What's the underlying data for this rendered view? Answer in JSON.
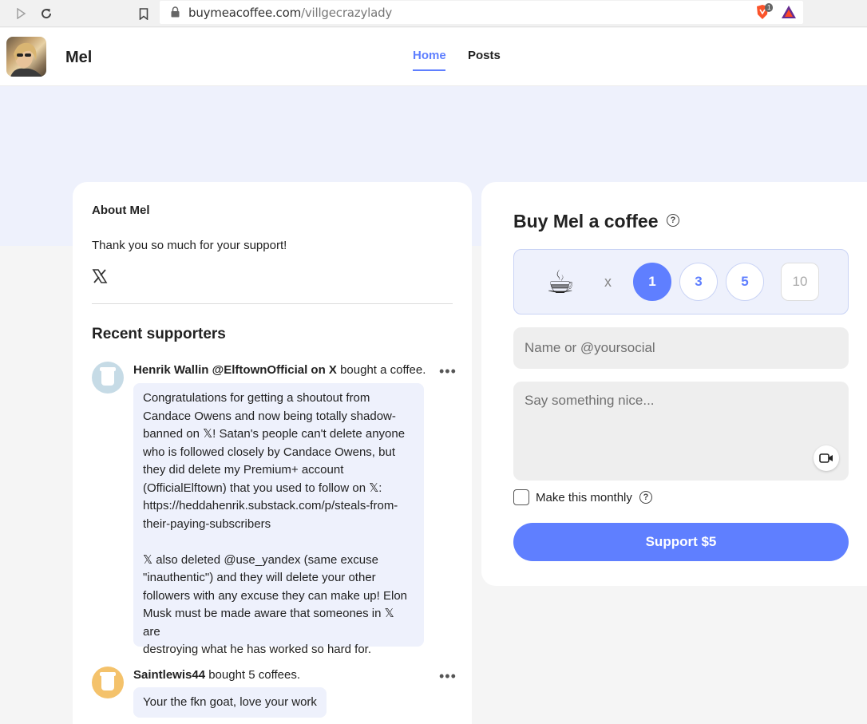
{
  "browser": {
    "url_host": "buymeacoffee.com",
    "url_path": "/villgecrazylady",
    "shield_count": "1"
  },
  "header": {
    "creator_name": "Mel",
    "tabs": [
      {
        "label": "Home",
        "active": true
      },
      {
        "label": "Posts",
        "active": false
      }
    ]
  },
  "about": {
    "title": "About Mel",
    "text": "Thank you so much for your support!",
    "social_icon": "x-logo-icon"
  },
  "recent": {
    "title": "Recent supporters",
    "supporters": [
      {
        "name": "Henrik Wallin @ElftownOfficial on X",
        "action": " bought a coffee.",
        "message": "Congratulations for getting a shoutout from\nCandace Owens and now being totally shadow-\nbanned on 𝕏! Satan's people can't delete anyone\nwho is followed closely by Candace Owens, but\nthey did delete my Premium+ account\n(OfficialElftown) that you used to follow on 𝕏:\nhttps://heddahenrik.substack.com/p/steals-from-\ntheir-paying-subscribers\n\n𝕏 also deleted @use_yandex (same excuse\n\"inauthentic\") and they will delete your other\nfollowers with any excuse they can make up! Elon\nMusk must be made aware that someones in 𝕏 are\ndestroying what he has worked so hard for."
      },
      {
        "name": "Saintlewis44",
        "action": " bought 5 coffees.",
        "message": "Your the fkn goat, love your work"
      }
    ]
  },
  "buy": {
    "title": "Buy Mel a coffee",
    "times": "x",
    "quantities": [
      "1",
      "3",
      "5",
      "10"
    ],
    "selected_quantity": "1",
    "name_placeholder": "Name or @yoursocial",
    "message_placeholder": "Say something nice...",
    "monthly_label": "Make this monthly",
    "support_label": "Support $5"
  },
  "colors": {
    "accent": "#5f7fff",
    "hero_bg": "#eef1fc"
  }
}
